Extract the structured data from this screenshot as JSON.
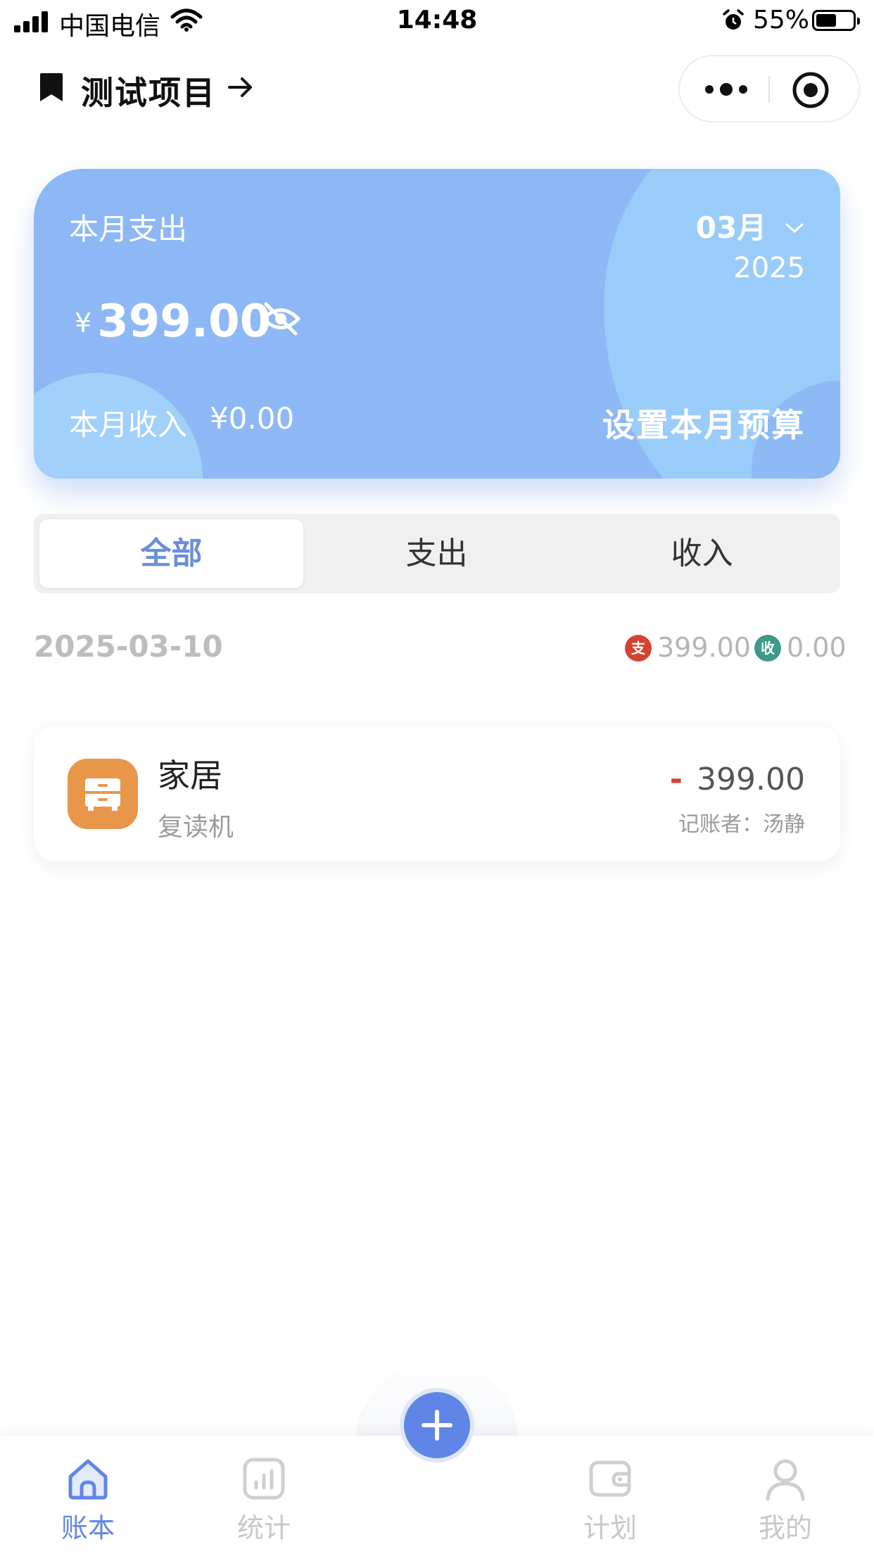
{
  "status_bar": {
    "carrier": "中国电信",
    "time": "14:48",
    "battery_percent": "55%",
    "battery_level": 0.55
  },
  "header": {
    "title": "测试项目"
  },
  "summary_card": {
    "expense_label": "本月支出",
    "month": "03月",
    "year": "2025",
    "currency_symbol": "¥",
    "expense_amount": "399.00",
    "income_label": "本月收入",
    "income_amount": "¥0.00",
    "budget_button": "设置本月预算"
  },
  "filter_tabs": {
    "items": [
      "全部",
      "支出",
      "收入"
    ],
    "active_index": 0
  },
  "day_group": {
    "date": "2025-03-10",
    "expense_tag": "支",
    "expense_total": "399.00",
    "income_tag": "收",
    "income_total": "0.00"
  },
  "transaction": {
    "category": "家居",
    "note": "复读机",
    "sign": "-",
    "amount": "399.00",
    "recorder": "记账者：汤静",
    "icon": "cabinet-icon"
  },
  "tabbar": {
    "items": [
      {
        "label": "账本",
        "icon": "home-icon"
      },
      {
        "label": "统计",
        "icon": "chart-icon"
      },
      {
        "label": "计划",
        "icon": "wallet-icon"
      },
      {
        "label": "我的",
        "icon": "person-icon"
      }
    ],
    "active_index": 0,
    "add_icon": "plus-icon"
  },
  "colors": {
    "accent": "#5f86e6",
    "card": "#8db8f5",
    "expense": "#d4432f",
    "income": "#3d9a86",
    "category": "#e8974a"
  }
}
